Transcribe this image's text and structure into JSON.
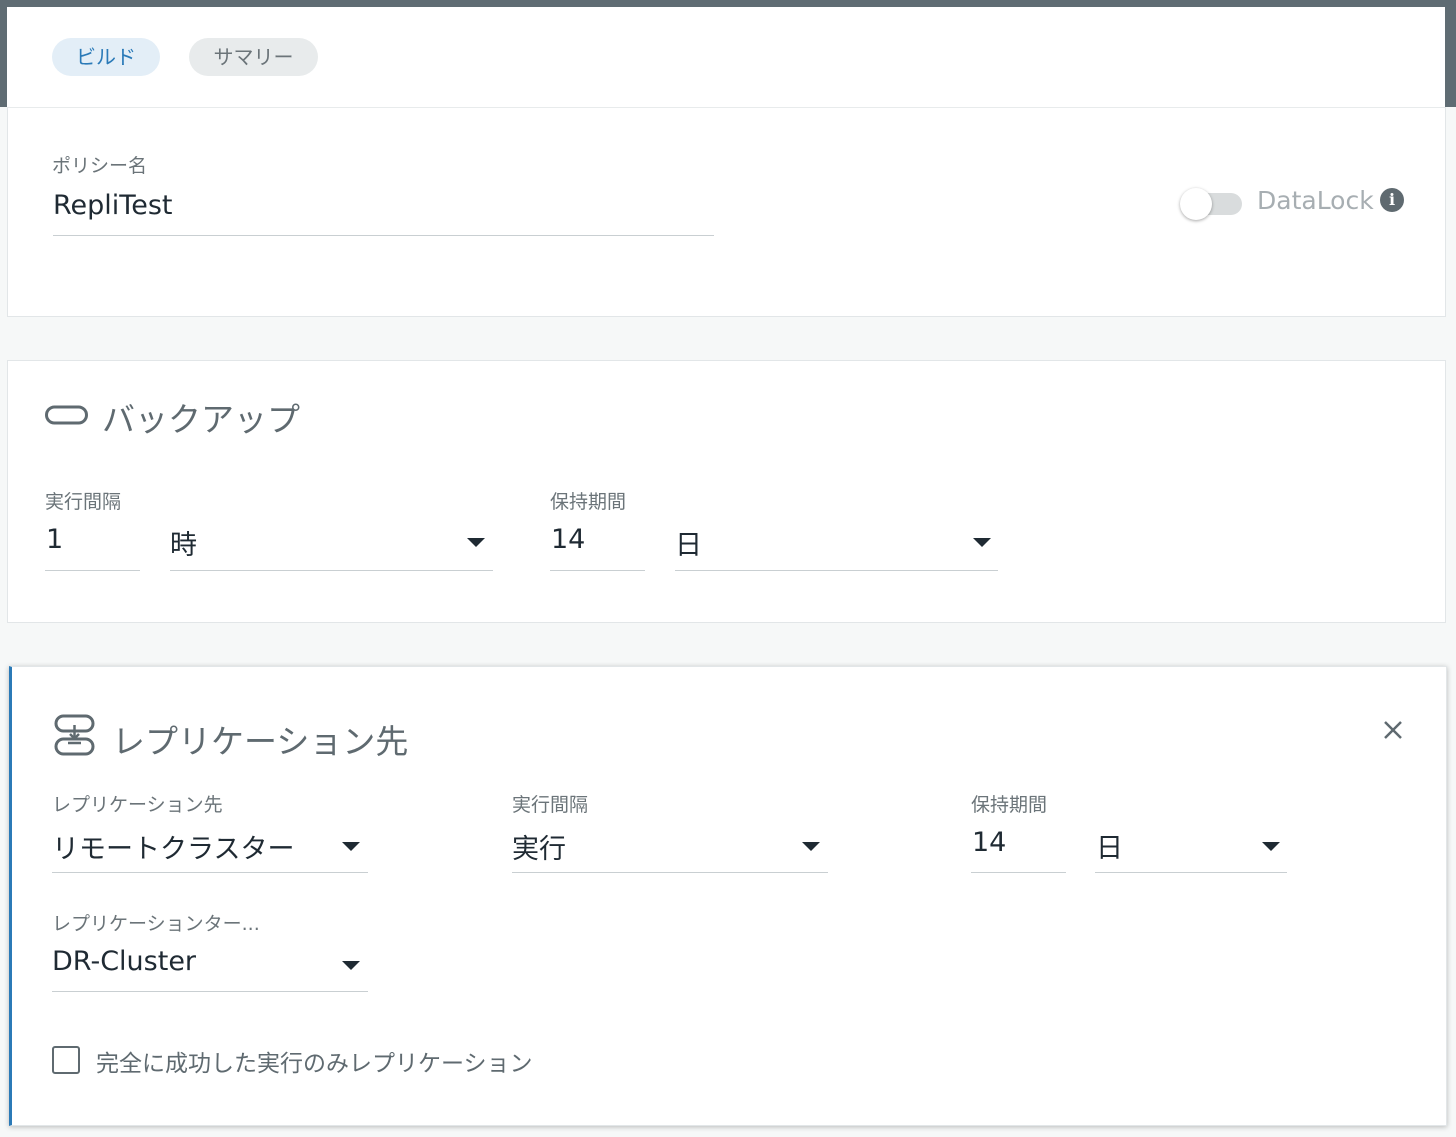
{
  "tabs": {
    "build": "ビルド",
    "summary": "サマリー"
  },
  "policy": {
    "name_label": "ポリシー名",
    "name_value": "RepliTest",
    "datalock_label": "DataLock",
    "datalock_enabled": false
  },
  "backup": {
    "title": "バックアップ",
    "interval_label": "実行間隔",
    "interval_value": "1",
    "interval_unit": "時",
    "retention_label": "保持期間",
    "retention_value": "14",
    "retention_unit": "日"
  },
  "replication": {
    "title": "レプリケーション先",
    "target_label": "レプリケーション先",
    "target_value": "リモートクラスター",
    "interval_label": "実行間隔",
    "interval_value": "実行",
    "retention_label": "保持期間",
    "retention_value": "14",
    "retention_unit": "日",
    "cluster_label": "レプリケーションター...",
    "cluster_value": "DR-Cluster",
    "checkbox_label": "完全に成功した実行のみレプリケーション",
    "checkbox_checked": false
  },
  "icons": {
    "backup": "pill-icon",
    "replication": "server-transfer-icon",
    "close": "close-icon",
    "info": "info-icon"
  },
  "colors": {
    "accent": "#2b7ab7",
    "chip_active_bg": "#e3eef7",
    "header_bar": "#5f6c73"
  }
}
